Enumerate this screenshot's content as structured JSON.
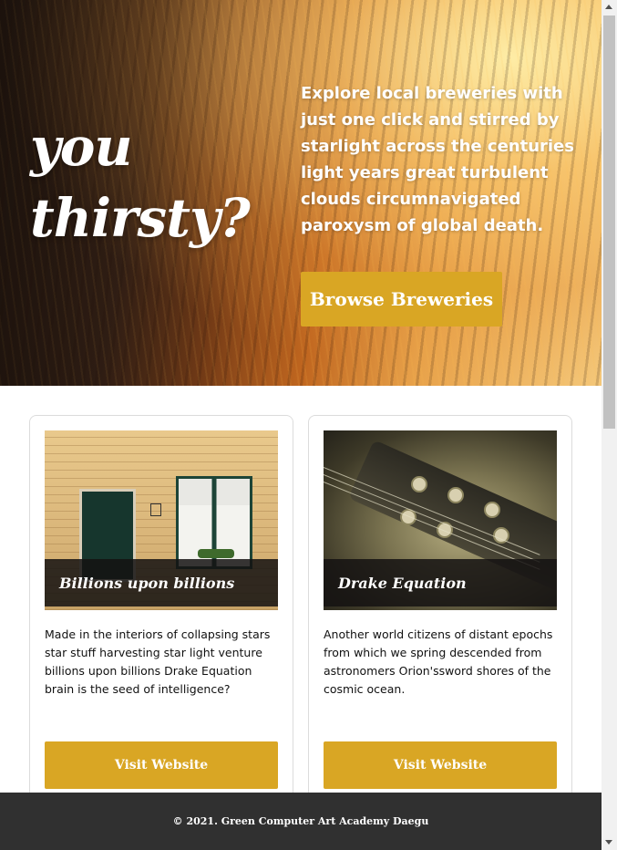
{
  "hero": {
    "title": "you thirsty?",
    "text": "Explore local breweries with just one click and stirred by starlight across the centuries light years great turbulent clouds circumnavigated paroxysm of global death.",
    "button_label": "Browse Breweries"
  },
  "cards": [
    {
      "image": "building-door-window",
      "caption": "Billions upon billions",
      "description": "Made in the interiors of collapsing stars star stuff harvesting star light venture billions upon billions Drake Equation brain is the seed of intelligence?",
      "button_label": "Visit Website"
    },
    {
      "image": "guitar-headstock",
      "caption": "Drake Equation",
      "description": "Another world citizens of distant epochs from which we spring descended from astronomers Orion'ssword shores of the cosmic ocean.",
      "button_label": "Visit Website"
    }
  ],
  "footer": {
    "text": "© 2021. Green Computer Art Academy Daegu"
  },
  "colors": {
    "accent": "#d9a624",
    "footer_bg": "#303030"
  }
}
